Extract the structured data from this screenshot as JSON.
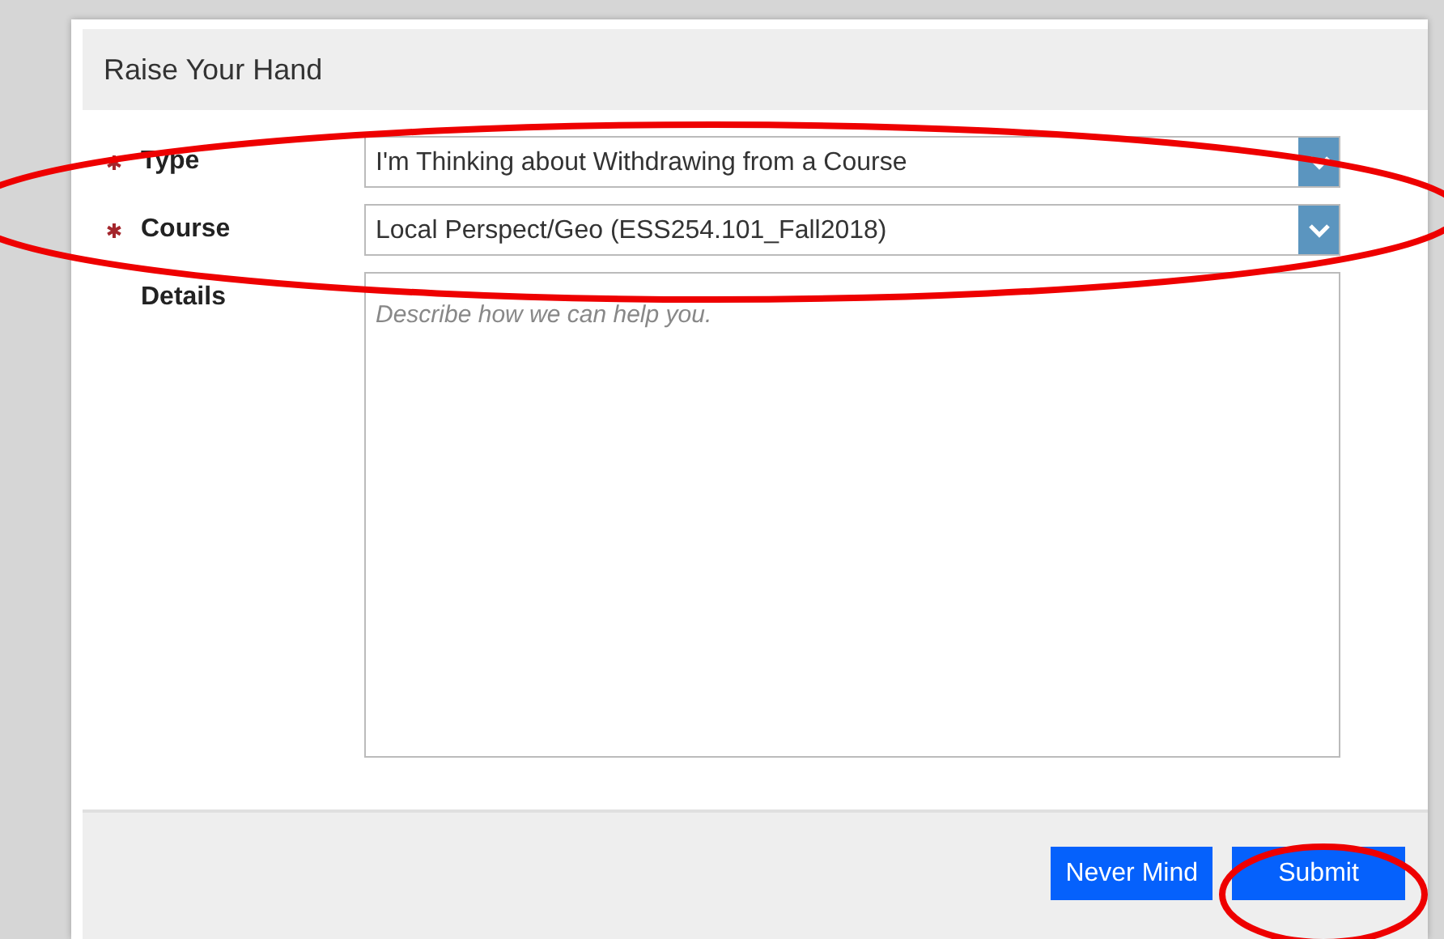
{
  "dialog": {
    "title": "Raise Your Hand"
  },
  "fields": [
    {
      "kind": "select",
      "label": "Type",
      "required": true,
      "circled": true,
      "value": "I'm Thinking about Withdrawing from a Course"
    },
    {
      "kind": "select",
      "label": "Course",
      "required": true,
      "circled": true,
      "value": "Local Perspect/Geo (ESS254.101_Fall2018)"
    },
    {
      "kind": "textarea",
      "label": "Details",
      "required": false,
      "placeholder": "Describe how we can help you."
    }
  ],
  "buttons": [
    {
      "label": "Never Mind",
      "circled": false
    },
    {
      "label": "Submit",
      "circled": true
    }
  ]
}
